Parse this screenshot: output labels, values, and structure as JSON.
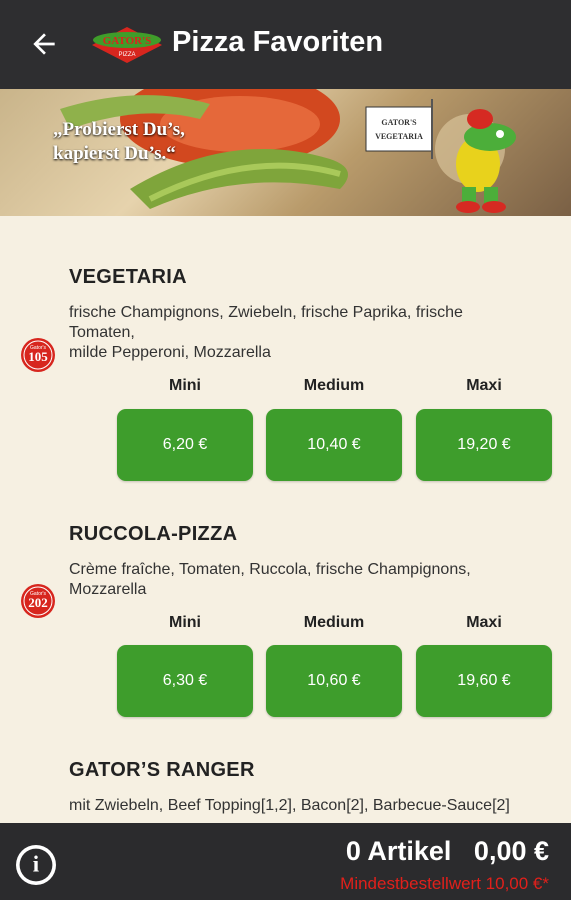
{
  "header": {
    "title": "Pizza Favoriten",
    "back_icon": "arrow-left-icon",
    "logo_text": "GATOR'S"
  },
  "banner": {
    "quote_line1": "„Probierst Du’s,",
    "quote_line2": "kapierst Du’s.“",
    "flag_line1": "GATOR'S",
    "flag_line2": "VEGETARIA"
  },
  "items": [
    {
      "name": "VEGETARIA",
      "desc_line1": "frische Champignons, Zwiebeln, frische Paprika, frische",
      "desc_line2": "Tomaten,",
      "desc_line3": "milde Pepperoni, Mozzarella",
      "badge_number": "105",
      "badge_word": "Gator's",
      "sizes": [
        "Mini",
        "Medium",
        "Maxi"
      ],
      "prices": [
        "6,20 €",
        "10,40 €",
        "19,20 €"
      ]
    },
    {
      "name": "RUCCOLA-PIZZA",
      "desc_line1": "Crème fraîche, Tomaten, Ruccola, frische Champignons,",
      "desc_line2": "Mozzarella",
      "badge_number": "202",
      "badge_word": "Gator's",
      "sizes": [
        "Mini",
        "Medium",
        "Maxi"
      ],
      "prices": [
        "6,30 €",
        "10,60 €",
        "19,60 €"
      ]
    },
    {
      "name": "GATOR’S RANGER",
      "desc_line1": "mit Zwiebeln, Beef Topping[1,2], Bacon[2], Barbecue-Sauce[2]"
    }
  ],
  "footer": {
    "count": "0 Artikel",
    "total": "0,00 €",
    "min_order": "Mindestbestellwert 10,00 €*",
    "info_icon": "info-icon",
    "info_glyph": "i"
  },
  "colors": {
    "appbar": "#2e2e30",
    "price_button": "#3e9d2c",
    "content_bg": "#f6f0e2",
    "min_order": "#e0201b"
  }
}
